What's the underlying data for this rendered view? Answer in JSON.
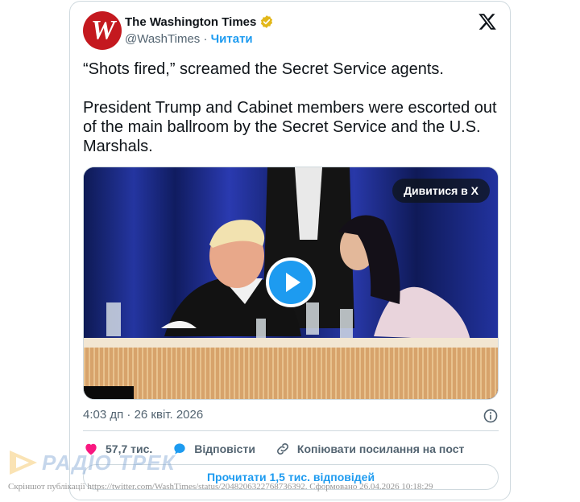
{
  "tweet": {
    "author_name": "The Washington Times",
    "avatar_letter": "W",
    "handle": "@WashTimes",
    "separator": "·",
    "follow_label": "Читати",
    "text_line1": "“Shots fired,” screamed the Secret Service agents.",
    "text_line2": "President Trump and Cabinet members were escorted out of the main ballroom by the Secret Service and the U.S. Marshals.",
    "watch_label": "Дивитися в X",
    "timestamp": "4:03 дп · 26 квіт. 2026",
    "likes": "57,7 тис.",
    "reply_label": "Відповісти",
    "copy_link_label": "Копіювати посилання на пост",
    "read_replies_label": "Прочитати 1,5 тис. відповідей"
  },
  "watermark": {
    "logo_text": "РАДІО ТРЕК",
    "caption": "Скріншот публікації https://twitter.com/WashTimes/status/2048206322768736392. Сформовано 26.04.2026 10:18:29"
  },
  "icons": {
    "verified": "verified-badge-icon",
    "x_logo": "x-logo-icon",
    "info": "info-icon",
    "like": "heart-icon",
    "reply": "reply-bubble-icon",
    "copy": "link-icon",
    "play": "play-icon"
  },
  "colors": {
    "accent": "#1d9bf0",
    "like": "#f91880",
    "avatar_bg": "#c4191f",
    "verified": "#e2b719"
  }
}
